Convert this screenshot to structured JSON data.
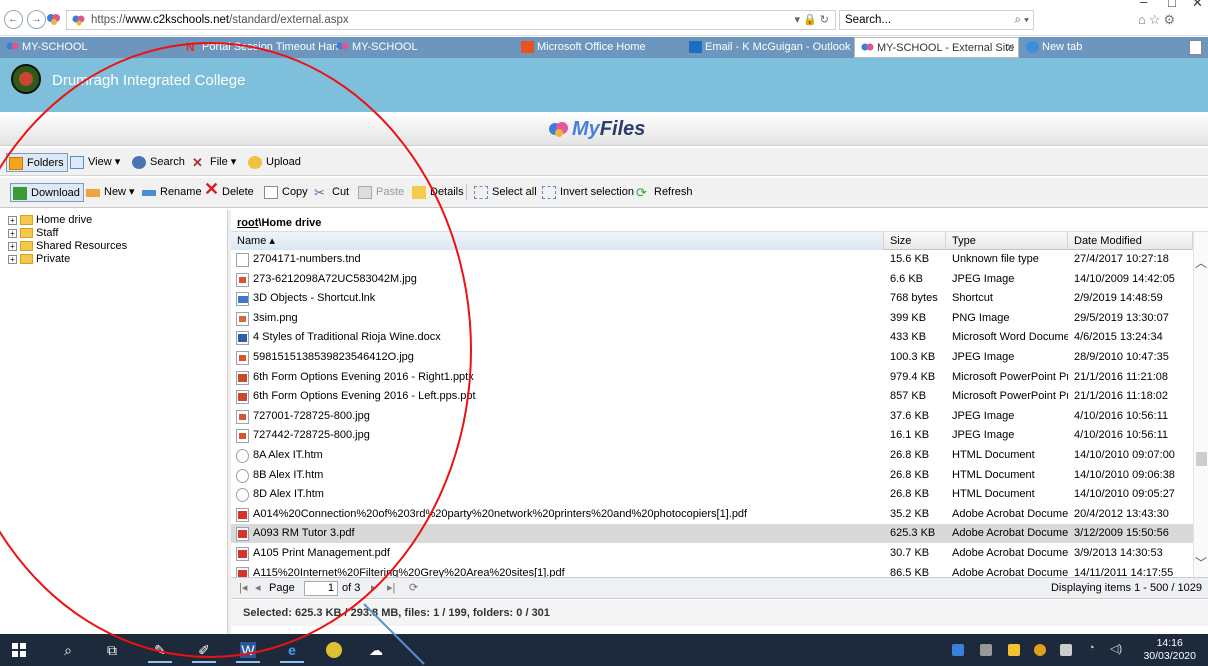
{
  "browser": {
    "url_prefix": "https://",
    "url_host": "www.c2kschools.net",
    "url_path": "/standard/external.aspx",
    "url_controls": "▾ 🔒 ↻",
    "search_placeholder": "Search...",
    "tabs": [
      {
        "label": "MY-SCHOOL"
      },
      {
        "label": "Portal Session Timeout Hand..."
      },
      {
        "label": "MY-SCHOOL"
      },
      {
        "label": "Microsoft Office Home"
      },
      {
        "label": "Email - K McGuigan - Outlook"
      },
      {
        "label": "MY-SCHOOL - External Site"
      },
      {
        "label": "New tab"
      }
    ]
  },
  "site": {
    "school_name": "Drumragh Integrated College",
    "app_title_my": "My",
    "app_title_rest": "Files"
  },
  "toolbar1": {
    "folders": "Folders",
    "view": "View ▾",
    "search": "Search",
    "file": "File ▾",
    "upload": "Upload"
  },
  "toolbar2": {
    "download": "Download",
    "new": "New ▾",
    "rename": "Rename",
    "delete": "Delete",
    "copy": "Copy",
    "cut": "Cut",
    "paste": "Paste",
    "details": "Details",
    "select_all": "Select all",
    "invert": "Invert selection",
    "refresh": "Refresh"
  },
  "tree": [
    {
      "label": "Home drive"
    },
    {
      "label": "Staff"
    },
    {
      "label": "Shared Resources"
    },
    {
      "label": "Private"
    }
  ],
  "grid": {
    "path_root": "root",
    "path_rest": "\\Home drive",
    "headers": {
      "name": "Name ▴",
      "size": "Size",
      "type": "Type",
      "date": "Date Modified"
    },
    "rows": [
      {
        "name": "2704171-numbers.tnd",
        "size": "15.6 KB",
        "type": "Unknown file type",
        "date": "27/4/2017 10:27:18",
        "icon": "blank"
      },
      {
        "name": "273-6212098A72UC583042M.jpg",
        "size": "6.6 KB",
        "type": "JPEG Image",
        "date": "14/10/2009 14:42:05",
        "icon": "jpg"
      },
      {
        "name": "3D Objects - Shortcut.lnk",
        "size": "768 bytes",
        "type": "Shortcut",
        "date": "2/9/2019 14:48:59",
        "icon": "lnk"
      },
      {
        "name": "3sim.png",
        "size": "399 KB",
        "type": "PNG Image",
        "date": "29/5/2019 13:30:07",
        "icon": "png"
      },
      {
        "name": "4 Styles of Traditional Rioja Wine.docx",
        "size": "433 KB",
        "type": "Microsoft Word Document",
        "date": "4/6/2015 13:24:34",
        "icon": "doc"
      },
      {
        "name": "5981515138539823546412O.jpg",
        "size": "100.3 KB",
        "type": "JPEG Image",
        "date": "28/9/2010 10:47:35",
        "icon": "jpg"
      },
      {
        "name": "6th Form Options Evening 2016 - Right1.pptx",
        "size": "979.4 KB",
        "type": "Microsoft PowerPoint Pr...",
        "date": "21/1/2016 11:21:08",
        "icon": "ppt"
      },
      {
        "name": "6th Form Options Evening 2016 - Left.pps.ppt",
        "size": "857 KB",
        "type": "Microsoft PowerPoint Pr...",
        "date": "21/1/2016 11:18:02",
        "icon": "ppt"
      },
      {
        "name": "727001-728725-800.jpg",
        "size": "37.6 KB",
        "type": "JPEG Image",
        "date": "4/10/2016 10:56:11",
        "icon": "jpg"
      },
      {
        "name": "727442-728725-800.jpg",
        "size": "16.1 KB",
        "type": "JPEG Image",
        "date": "4/10/2016 10:56:11",
        "icon": "jpg"
      },
      {
        "name": "8A Alex IT.htm",
        "size": "26.8 KB",
        "type": "HTML Document",
        "date": "14/10/2010 09:07:00",
        "icon": "htm"
      },
      {
        "name": "8B Alex IT.htm",
        "size": "26.8 KB",
        "type": "HTML Document",
        "date": "14/10/2010 09:06:38",
        "icon": "htm"
      },
      {
        "name": "8D Alex IT.htm",
        "size": "26.8 KB",
        "type": "HTML Document",
        "date": "14/10/2010 09:05:27",
        "icon": "htm"
      },
      {
        "name": "A014%20Connection%20of%203rd%20party%20network%20printers%20and%20photocopiers[1].pdf",
        "size": "35.2 KB",
        "type": "Adobe Acrobat Document",
        "date": "20/4/2012 13:43:30",
        "icon": "pdf"
      },
      {
        "name": "A093 RM Tutor 3.pdf",
        "size": "625.3 KB",
        "type": "Adobe Acrobat Document",
        "date": "3/12/2009 15:50:56",
        "icon": "pdf",
        "selected": true
      },
      {
        "name": "A105 Print Management.pdf",
        "size": "30.7 KB",
        "type": "Adobe Acrobat Document",
        "date": "3/9/2013 14:30:53",
        "icon": "pdf"
      },
      {
        "name": "A115%20Internet%20Filtering%20Grey%20Area%20sites[1].pdf",
        "size": "86.5 KB",
        "type": "Adobe Acrobat Document",
        "date": "14/11/2011 14:17:55",
        "icon": "pdf"
      }
    ]
  },
  "pager": {
    "page_label": "Page",
    "page_value": "1",
    "of_label": "of 3",
    "display": "Displaying items 1 - 500 / 1029"
  },
  "status": {
    "text": "Selected: 625.3 KB / 293.8 MB, files: 1 / 199, folders: 0 / 301"
  },
  "taskbar": {
    "time": "14:16",
    "date": "30/03/2020"
  },
  "colors": {
    "accent": "#7ebfdb",
    "tabs_bg": "#6d96bf",
    "taskbar": "#1c2a3b",
    "annotation": "#e11"
  }
}
